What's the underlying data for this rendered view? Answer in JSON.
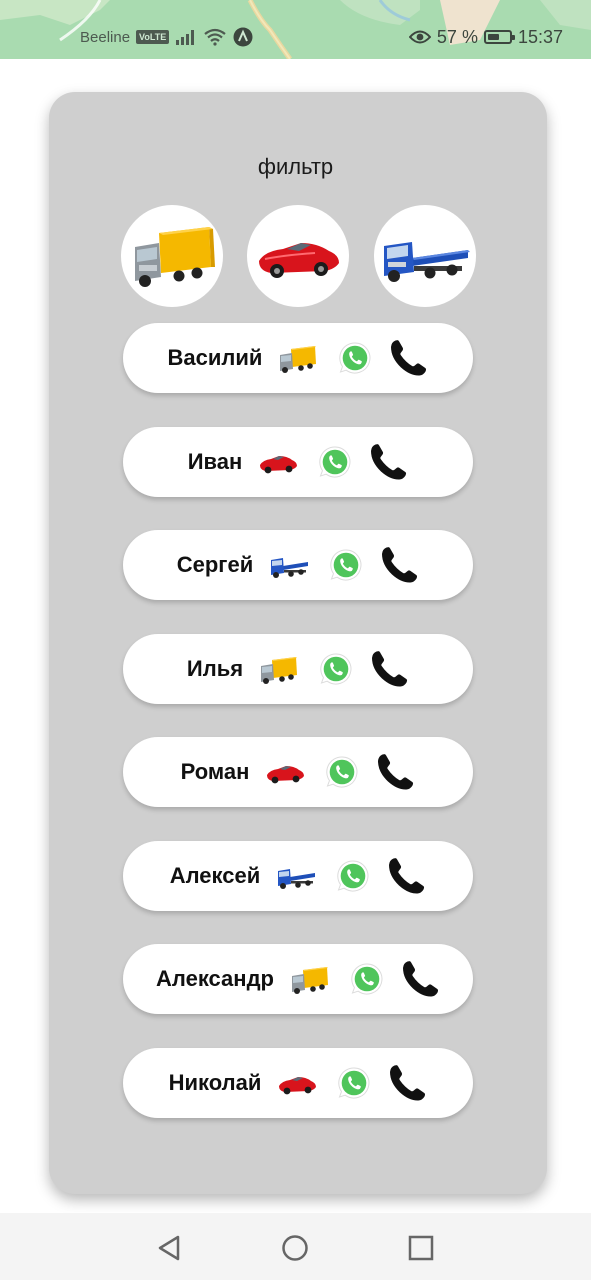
{
  "status_bar": {
    "carrier": "Beeline",
    "network_badge": "VoLTE",
    "battery_percent": "57 %",
    "battery_level": 0.57,
    "time": "15:37",
    "icons": [
      "signal-icon",
      "wifi-icon",
      "data-saver-icon",
      "eye-icon",
      "battery-icon"
    ]
  },
  "filter": {
    "title": "фильтр",
    "options": [
      "truck-icon",
      "car-icon",
      "tow-truck-icon"
    ]
  },
  "contacts": [
    {
      "name": "Василий",
      "vehicle": "truck"
    },
    {
      "name": "Иван",
      "vehicle": "car"
    },
    {
      "name": "Сергей",
      "vehicle": "tow-truck"
    },
    {
      "name": "Илья",
      "vehicle": "truck"
    },
    {
      "name": "Роман",
      "vehicle": "car"
    },
    {
      "name": "Алексей",
      "vehicle": "tow-truck"
    },
    {
      "name": "Александр",
      "vehicle": "truck"
    },
    {
      "name": "Николай",
      "vehicle": "car"
    }
  ],
  "colors": {
    "card_bg": "#cfcfcf",
    "whatsapp_green": "#4fc55b",
    "status_bar_bg": "#a9dbb0",
    "truck_cargo": "#f5b800",
    "car_red": "#d8141c",
    "tow_truck_blue": "#1e4fb8"
  },
  "nav_bar": {
    "icons": [
      "back-icon",
      "home-icon",
      "recents-icon"
    ]
  }
}
